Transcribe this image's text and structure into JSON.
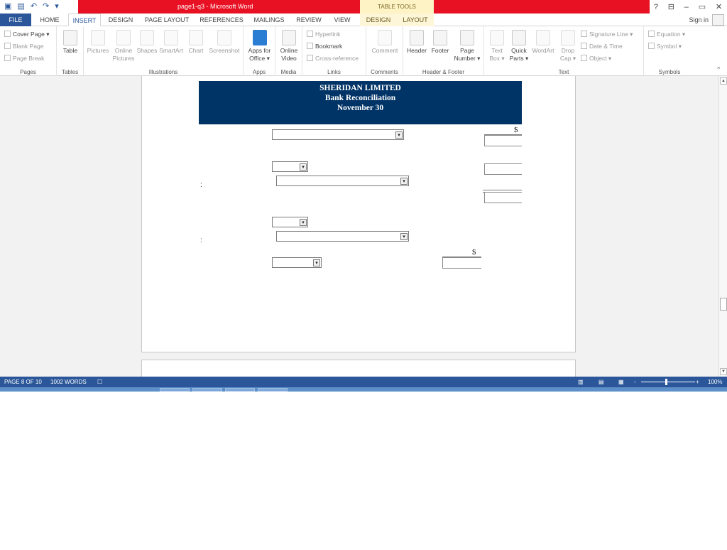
{
  "title_bar": {
    "document_title": "page1-q3 - Microsoft Word",
    "contextual_group": "TABLE TOOLS",
    "help": "?",
    "minimize": "–",
    "restore": "▭",
    "close": "✕"
  },
  "tabs": {
    "file": "FILE",
    "home": "HOME",
    "insert": "INSERT",
    "design": "DESIGN",
    "page_layout": "PAGE LAYOUT",
    "references": "REFERENCES",
    "mailings": "MAILINGS",
    "review": "REVIEW",
    "view": "VIEW",
    "table_design": "DESIGN",
    "table_layout": "LAYOUT",
    "sign_in": "Sign in"
  },
  "ribbon": {
    "pages": {
      "label": "Pages",
      "cover_page": "Cover Page ▾",
      "blank_page": "Blank Page",
      "page_break": "Page Break"
    },
    "tables": {
      "label": "Tables",
      "table": "Table"
    },
    "illustrations": {
      "label": "Illustrations",
      "pictures": "Pictures",
      "online_pictures": "Online Pictures",
      "shapes": "Shapes",
      "smartart": "SmartArt",
      "chart": "Chart",
      "screenshot": "Screenshot"
    },
    "apps": {
      "label": "Apps",
      "apps_for_office": "Apps for Office ▾"
    },
    "media": {
      "label": "Media",
      "online_video": "Online Video"
    },
    "links": {
      "label": "Links",
      "hyperlink": "Hyperlink",
      "bookmark": "Bookmark",
      "cross_reference": "Cross-reference"
    },
    "comments": {
      "label": "Comments",
      "comment": "Comment"
    },
    "header_footer": {
      "label": "Header & Footer",
      "header": "Header",
      "footer": "Footer",
      "page_number": "Page Number ▾"
    },
    "text": {
      "label": "Text",
      "text_box": "Text Box ▾",
      "quick_parts": "Quick Parts ▾",
      "wordart": "WordArt",
      "drop_cap": "Drop Cap ▾",
      "signature_line": "Signature Line ▾",
      "date_time": "Date & Time",
      "object": "Object ▾"
    },
    "symbols": {
      "label": "Symbols",
      "equation": "Equation ▾",
      "symbol": "Symbol ▾"
    }
  },
  "document": {
    "company": "SHERIDAN LIMITED",
    "report": "Bank Reconciliation",
    "date": "November 30",
    "currency_symbol_1": "$",
    "currency_symbol_2": "$",
    "colon_1": ":",
    "colon_2": ":"
  },
  "status_bar": {
    "page": "PAGE 8 OF 10",
    "words": "1002 WORDS",
    "zoom": "100%",
    "zoom_minus": "-",
    "zoom_plus": "+"
  },
  "colors": {
    "word_blue": "#2b579a",
    "title_red": "#e81123",
    "header_band": "#003366"
  }
}
